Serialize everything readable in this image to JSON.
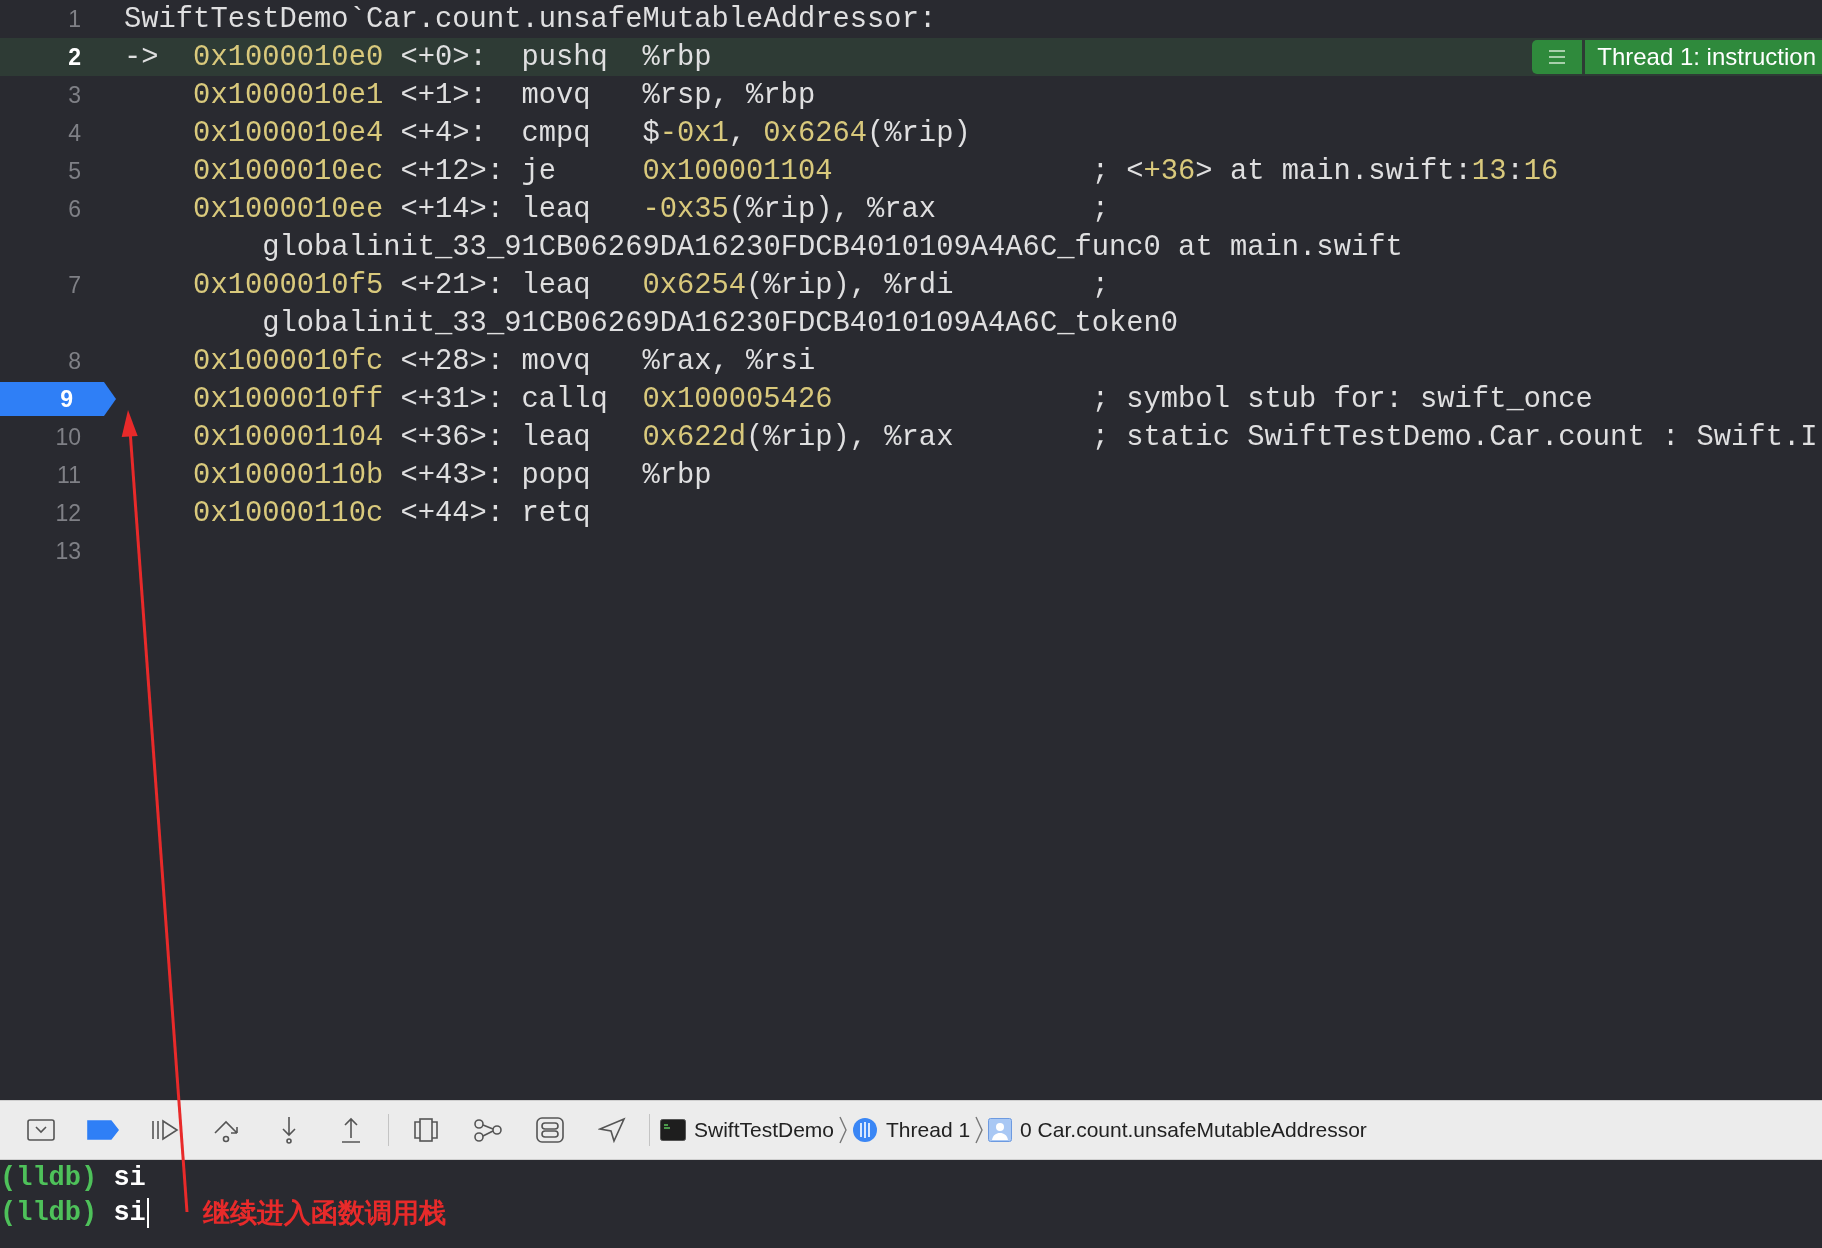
{
  "editor": {
    "current_line_badge": {
      "text": "Thread 1: instruction"
    },
    "lines": [
      {
        "number": "1",
        "current": false,
        "breakpoint": false,
        "kind": "header",
        "text": "SwiftTestDemo`Car.count.unsafeMutableAddressor:"
      },
      {
        "number": "2",
        "current": true,
        "breakpoint": false,
        "kind": "instruction",
        "pc_arrow": "->",
        "address": "0x1000010e0",
        "offset": "<+0>:",
        "mnemonic": "pushq",
        "operands": [
          {
            "text": "%rbp",
            "kind": "plain"
          }
        ]
      },
      {
        "number": "3",
        "current": false,
        "breakpoint": false,
        "kind": "instruction",
        "address": "0x1000010e1",
        "offset": "<+1>:",
        "mnemonic": "movq",
        "operands": [
          {
            "text": "%rsp, %rbp",
            "kind": "plain"
          }
        ]
      },
      {
        "number": "4",
        "current": false,
        "breakpoint": false,
        "kind": "instruction",
        "address": "0x1000010e4",
        "offset": "<+4>:",
        "mnemonic": "cmpq",
        "operands": [
          {
            "text": "$",
            "kind": "plain"
          },
          {
            "text": "-0x1",
            "kind": "number"
          },
          {
            "text": ", ",
            "kind": "plain"
          },
          {
            "text": "0x6264",
            "kind": "number"
          },
          {
            "text": "(%rip)",
            "kind": "plain"
          }
        ]
      },
      {
        "number": "5",
        "current": false,
        "breakpoint": false,
        "kind": "instruction",
        "address": "0x1000010ec",
        "offset": "<+12>:",
        "mnemonic": "je",
        "operands": [
          {
            "text": "0x100001104",
            "kind": "number"
          }
        ],
        "comment": [
          {
            "text": "; <",
            "kind": "plain"
          },
          {
            "text": "+36",
            "kind": "number"
          },
          {
            "text": "> at main.swift:",
            "kind": "plain"
          },
          {
            "text": "13",
            "kind": "number"
          },
          {
            "text": ":",
            "kind": "plain"
          },
          {
            "text": "16",
            "kind": "number"
          }
        ]
      },
      {
        "number": "6",
        "current": false,
        "breakpoint": false,
        "kind": "instruction",
        "address": "0x1000010ee",
        "offset": "<+14>:",
        "mnemonic": "leaq",
        "operands": [
          {
            "text": "-0x35",
            "kind": "number"
          },
          {
            "text": "(%rip), %rax",
            "kind": "plain"
          }
        ],
        "comment": [
          {
            "text": ";",
            "kind": "plain"
          }
        ],
        "continuation": "globalinit_33_91CB06269DA16230FDCB4010109A4A6C_func0 at main.swift"
      },
      {
        "number": "7",
        "current": false,
        "breakpoint": false,
        "kind": "instruction",
        "address": "0x1000010f5",
        "offset": "<+21>:",
        "mnemonic": "leaq",
        "operands": [
          {
            "text": "0x6254",
            "kind": "number"
          },
          {
            "text": "(%rip), %rdi",
            "kind": "plain"
          }
        ],
        "comment": [
          {
            "text": ";",
            "kind": "plain"
          }
        ],
        "continuation": "globalinit_33_91CB06269DA16230FDCB4010109A4A6C_token0"
      },
      {
        "number": "8",
        "current": false,
        "breakpoint": false,
        "kind": "instruction",
        "address": "0x1000010fc",
        "offset": "<+28>:",
        "mnemonic": "movq",
        "operands": [
          {
            "text": "%rax, %rsi",
            "kind": "plain"
          }
        ]
      },
      {
        "number": "9",
        "current": false,
        "breakpoint": true,
        "kind": "instruction",
        "address": "0x1000010ff",
        "offset": "<+31>:",
        "mnemonic": "callq",
        "operands": [
          {
            "text": "0x100005426",
            "kind": "number"
          }
        ],
        "comment": [
          {
            "text": "; symbol stub for: swift_once",
            "kind": "plain"
          }
        ]
      },
      {
        "number": "10",
        "current": false,
        "breakpoint": false,
        "kind": "instruction",
        "address": "0x100001104",
        "offset": "<+36>:",
        "mnemonic": "leaq",
        "operands": [
          {
            "text": "0x622d",
            "kind": "number"
          },
          {
            "text": "(%rip), %rax",
            "kind": "plain"
          }
        ],
        "comment": [
          {
            "text": "; static SwiftTestDemo.Car.count : Swift.I",
            "kind": "plain"
          }
        ]
      },
      {
        "number": "11",
        "current": false,
        "breakpoint": false,
        "kind": "instruction",
        "address": "0x10000110b",
        "offset": "<+43>:",
        "mnemonic": "popq",
        "operands": [
          {
            "text": "%rbp",
            "kind": "plain"
          }
        ]
      },
      {
        "number": "12",
        "current": false,
        "breakpoint": false,
        "kind": "instruction",
        "address": "0x10000110c",
        "offset": "<+44>:",
        "mnemonic": "retq"
      },
      {
        "number": "13",
        "current": false,
        "breakpoint": false,
        "kind": "empty"
      }
    ]
  },
  "debug_bar": {
    "breakpoints_active": true,
    "breadcrumbs": [
      {
        "kind": "process",
        "label": "SwiftTestDemo"
      },
      {
        "kind": "thread",
        "label": "Thread 1"
      },
      {
        "kind": "frame",
        "label": "0 Car.count.unsafeMutableAddressor"
      }
    ]
  },
  "console": {
    "lines": [
      {
        "prompt": "(lldb)",
        "command": "si",
        "cursor": false
      },
      {
        "prompt": "(lldb)",
        "command": "si",
        "cursor": true
      }
    ]
  },
  "annotation": {
    "text": "继续进入函数调用栈"
  }
}
